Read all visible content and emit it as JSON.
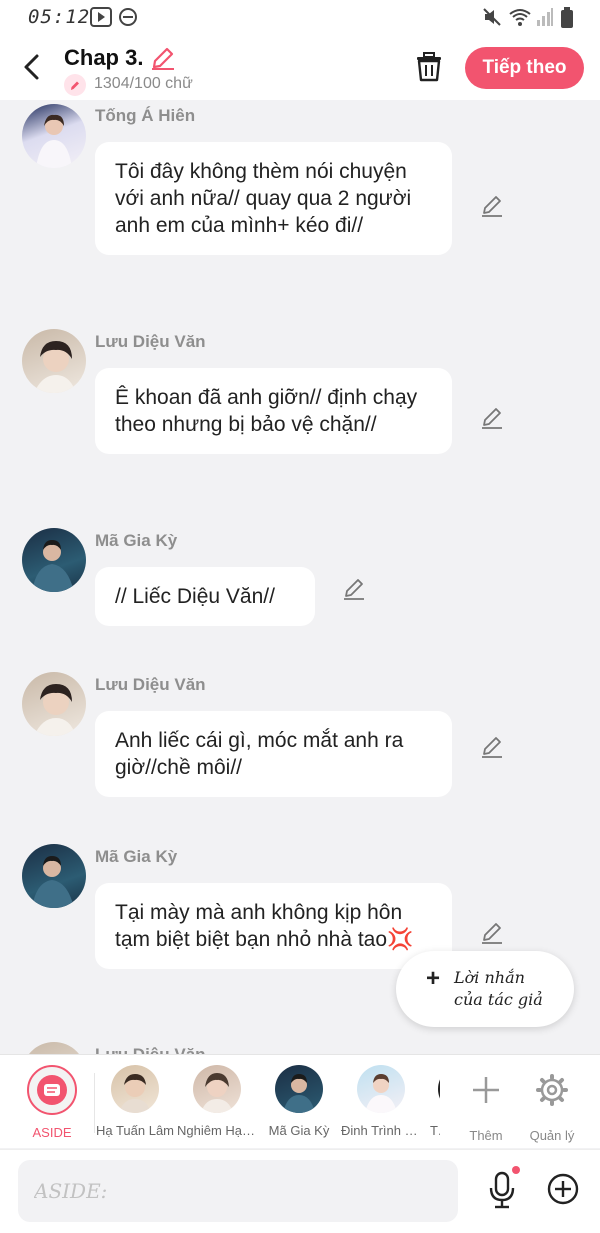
{
  "status_bar": {
    "time": "05:12"
  },
  "header": {
    "title": "Chap 3.",
    "word_count": "1304/100 chữ",
    "next_label": "Tiếp theo"
  },
  "messages": [
    {
      "author": "Tống Á Hiên",
      "text": "Tôi đây không thèm nói chuyện với anh nữa// quay qua 2 người anh em của mình+ kéo đi//"
    },
    {
      "author": "Lưu Diệu Văn",
      "text": "Ê khoan đã anh giỡn// định chạy theo nhưng bị bảo vệ chặn//"
    },
    {
      "author": "Mã Gia Kỳ",
      "text": "// Liếc Diệu Văn//"
    },
    {
      "author": "Lưu Diệu Văn",
      "text": "Anh liếc cái gì, móc mắt anh ra giờ//chề môi//"
    },
    {
      "author": "Mã Gia Kỳ",
      "text": "Tại mày mà anh không kịp hôn tạm biệt biệt bạn nhỏ nhà tao💢"
    },
    {
      "author": "Lưu Diệu Văn",
      "text": ""
    }
  ],
  "author_note": {
    "plus": "+",
    "line1": "Lời nhắn",
    "line2": "của tác giả"
  },
  "characters": [
    {
      "name": "ASIDE"
    },
    {
      "name": "Hạ Tuấn Lâm"
    },
    {
      "name": "Nghiêm Hạo Tường"
    },
    {
      "name": "Mã Gia Kỳ"
    },
    {
      "name": "Đinh Trình Hâm"
    },
    {
      "name": "Tr"
    }
  ],
  "tools": {
    "add_label": "Thêm",
    "manage_label": "Quản lý"
  },
  "input": {
    "placeholder": "ASIDE:"
  },
  "colors": {
    "accent": "#f2546f",
    "background": "#f2f2f4",
    "bubble": "#ffffff",
    "author_name": "#8e8e8e"
  }
}
